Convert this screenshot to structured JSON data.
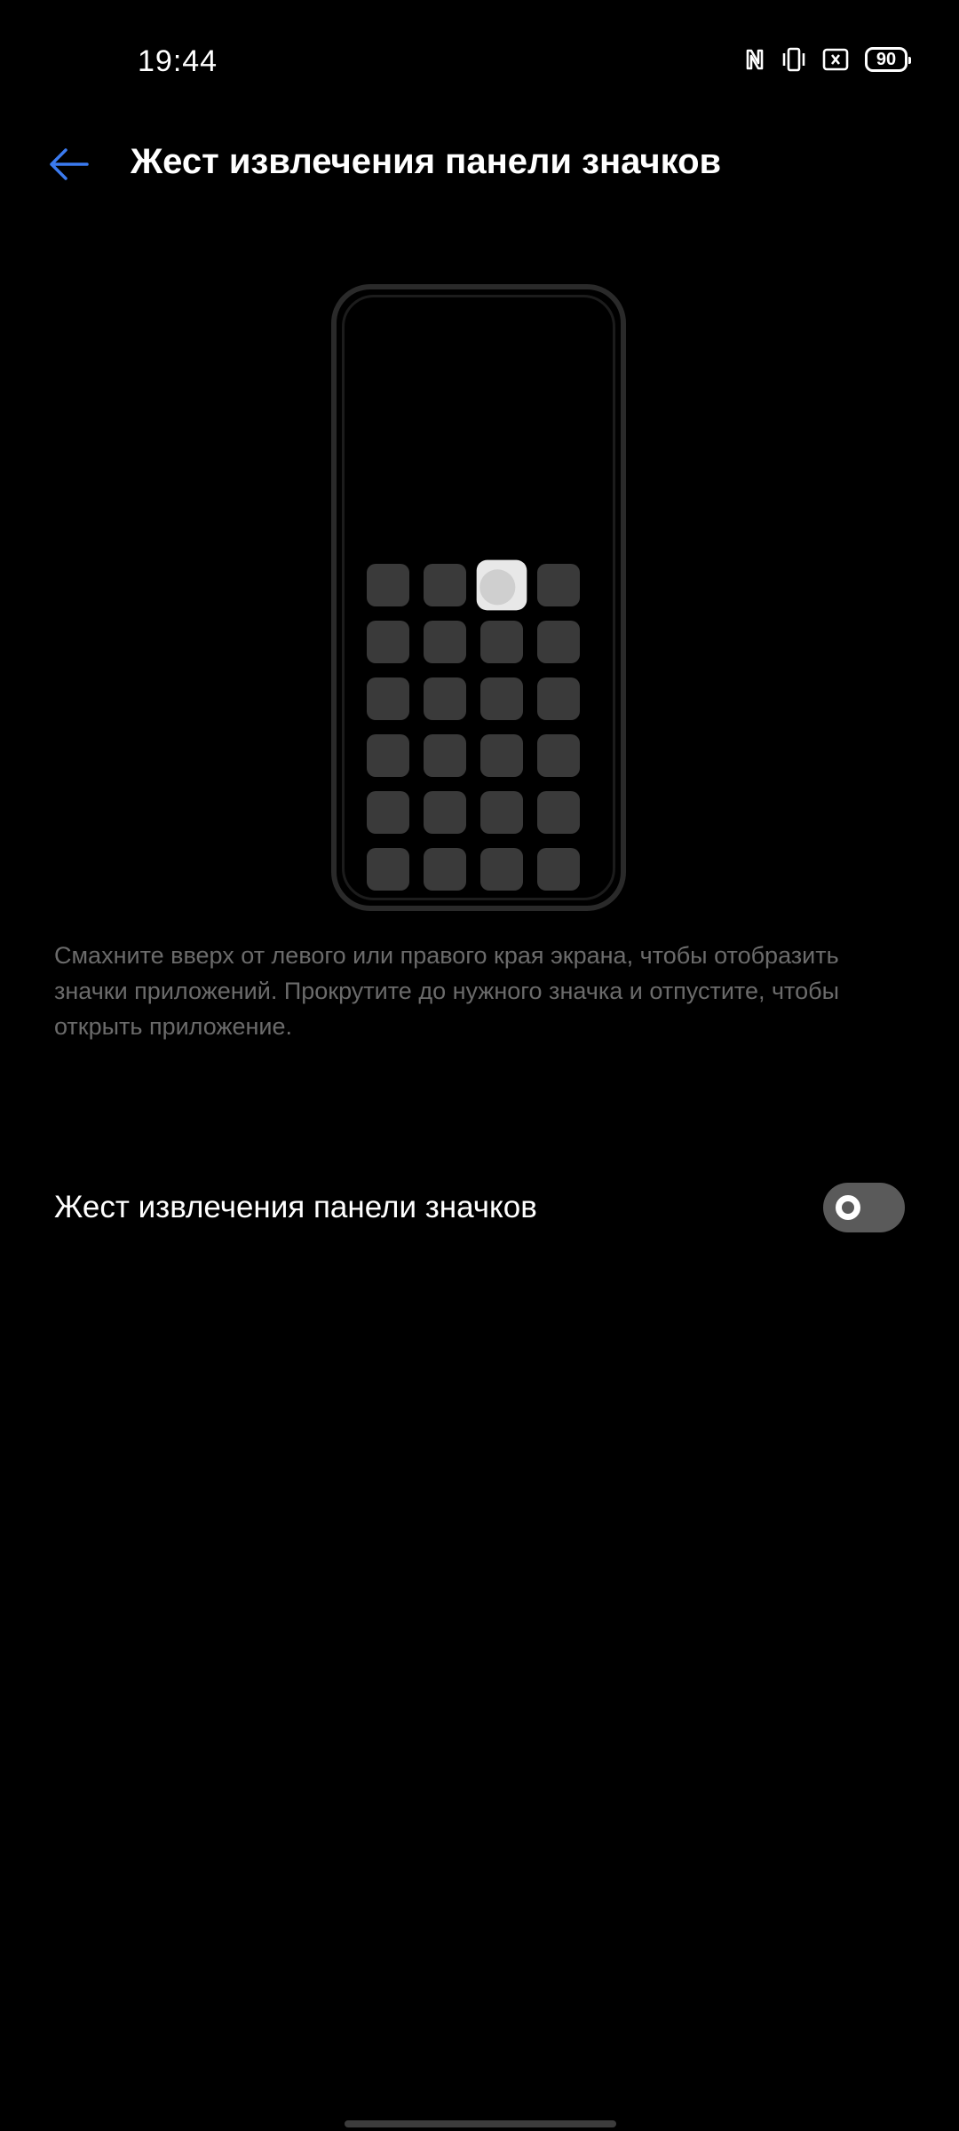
{
  "status_bar": {
    "time": "19:44",
    "icons": [
      "nfc-icon",
      "vibrate-icon",
      "sim-icon"
    ],
    "battery_level": "90"
  },
  "header": {
    "title": "Жест извлечения панели значков",
    "back_icon": "arrow-left-icon",
    "accent_color": "#3b7bf0"
  },
  "illustration": {
    "rows": 6,
    "columns": 4,
    "highlighted_tile": 3
  },
  "description": "Смахните вверх от левого или правого края экрана, чтобы отобразить значки приложений. Прокрутите до нужного значка и отпустите, чтобы открыть приложение.",
  "setting": {
    "label": "Жест извлечения панели значков",
    "enabled": false
  }
}
